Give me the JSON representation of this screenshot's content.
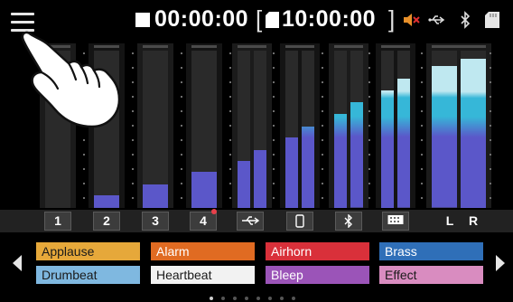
{
  "status_bar": {
    "record_time": "00:00:00",
    "remaining_time": "10:00:00",
    "bracket_open": "[",
    "bracket_close": "]",
    "icons": [
      "menu-icon",
      "stop-icon",
      "sd-card-icon",
      "speaker-muted-icon",
      "usb-icon",
      "bluetooth-icon",
      "sd-card-icon"
    ]
  },
  "channels": [
    {
      "label": "1",
      "level_left": 0.0,
      "level_right": 0.0
    },
    {
      "label": "2",
      "level_left": 0.08,
      "level_right": 0.08,
      "type": "stereo-pad"
    },
    {
      "label": "3",
      "level_left": 0.15,
      "level_right": 0.15,
      "type": "stereo-pad"
    },
    {
      "label": "4",
      "level_left": 0.23,
      "level_right": 0.23,
      "type": "stereo-pad",
      "recording_indicator": true
    },
    {
      "label": "usb-icon",
      "level_left": 0.3,
      "level_right": 0.37
    },
    {
      "label": "phone-icon",
      "level_left": 0.45,
      "level_right": 0.52
    },
    {
      "label": "bluetooth-icon",
      "level_left": 0.6,
      "level_right": 0.67
    },
    {
      "label": "keypad-icon",
      "level_left": 0.75,
      "level_right": 0.82
    },
    {
      "label_left": "L",
      "label_right": "R",
      "level_left": 0.9,
      "level_right": 0.95,
      "type": "master"
    }
  ],
  "pads": [
    {
      "label": "Applause",
      "color": "#e6a83a",
      "text_color": "#1a1a1a"
    },
    {
      "label": "Alarm",
      "color": "#e06b22",
      "text_color": "#ffffff"
    },
    {
      "label": "Airhorn",
      "color": "#d9303a",
      "text_color": "#ffffff"
    },
    {
      "label": "Brass",
      "color": "#2f6fb8",
      "text_color": "#ffffff"
    },
    {
      "label": "Drumbeat",
      "color": "#7fb8e0",
      "text_color": "#1a1a1a"
    },
    {
      "label": "Heartbeat",
      "color": "#f2f2f2",
      "text_color": "#1a1a1a"
    },
    {
      "label": "Bleep",
      "color": "#9b54b8",
      "text_color": "#ffffff"
    },
    {
      "label": "Effect",
      "color": "#d98cc0",
      "text_color": "#1a1a1a"
    }
  ],
  "pagination": {
    "total": 8,
    "current": 1
  },
  "colors": {
    "meter_low": "#5b57c9",
    "meter_mid": "#36b7d8",
    "meter_peak": "#bfe8f0"
  }
}
